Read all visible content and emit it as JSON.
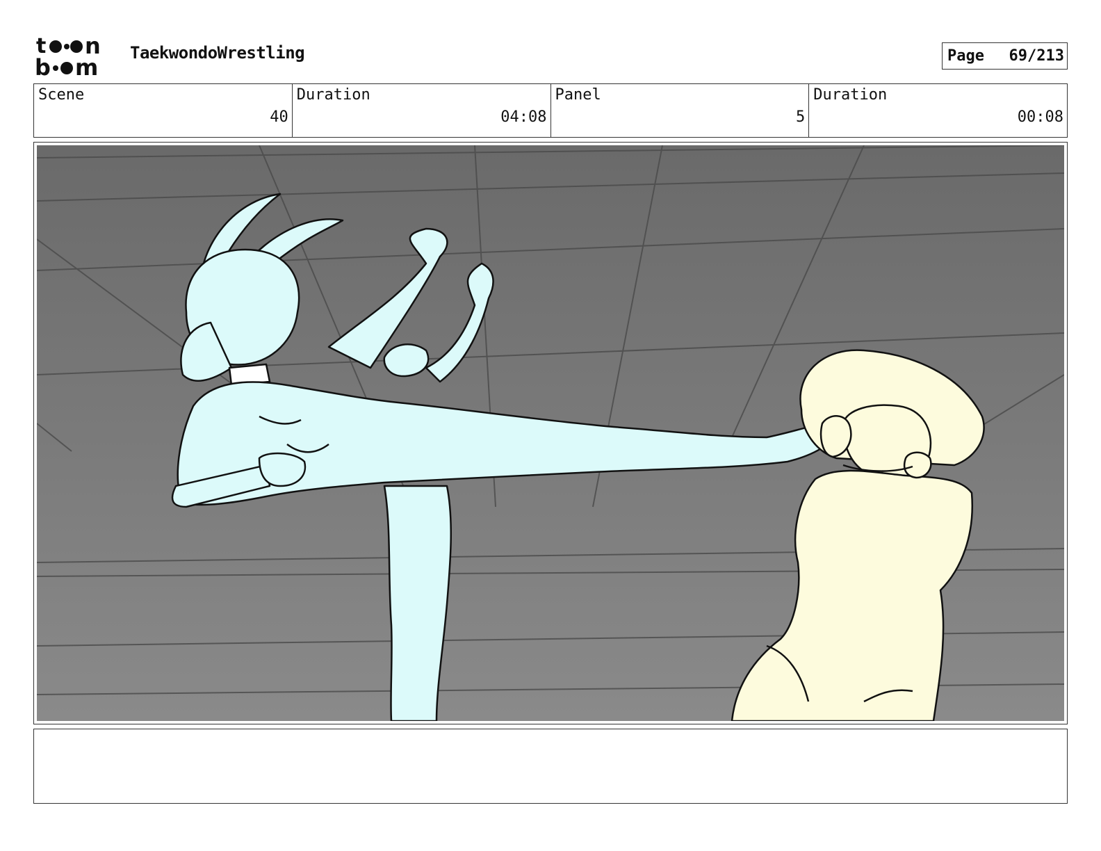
{
  "logo": {
    "line1": "toon",
    "line2": "boom"
  },
  "header": {
    "title": "TaekwondoWrestling",
    "page_label": "Page",
    "page_value": "69/213"
  },
  "info": {
    "scene_label": "Scene",
    "scene_value": "40",
    "duration_label": "Duration",
    "duration_value": "04:08",
    "panel_label": "Panel",
    "panel_value": "5",
    "panel_duration_label": "Duration",
    "panel_duration_value": "00:08"
  },
  "panel_image": {
    "character_left_color": "#dcfafa",
    "character_right_color": "#fdfbdd",
    "background": "#7a7a7a"
  },
  "notes": {
    "text": ""
  }
}
